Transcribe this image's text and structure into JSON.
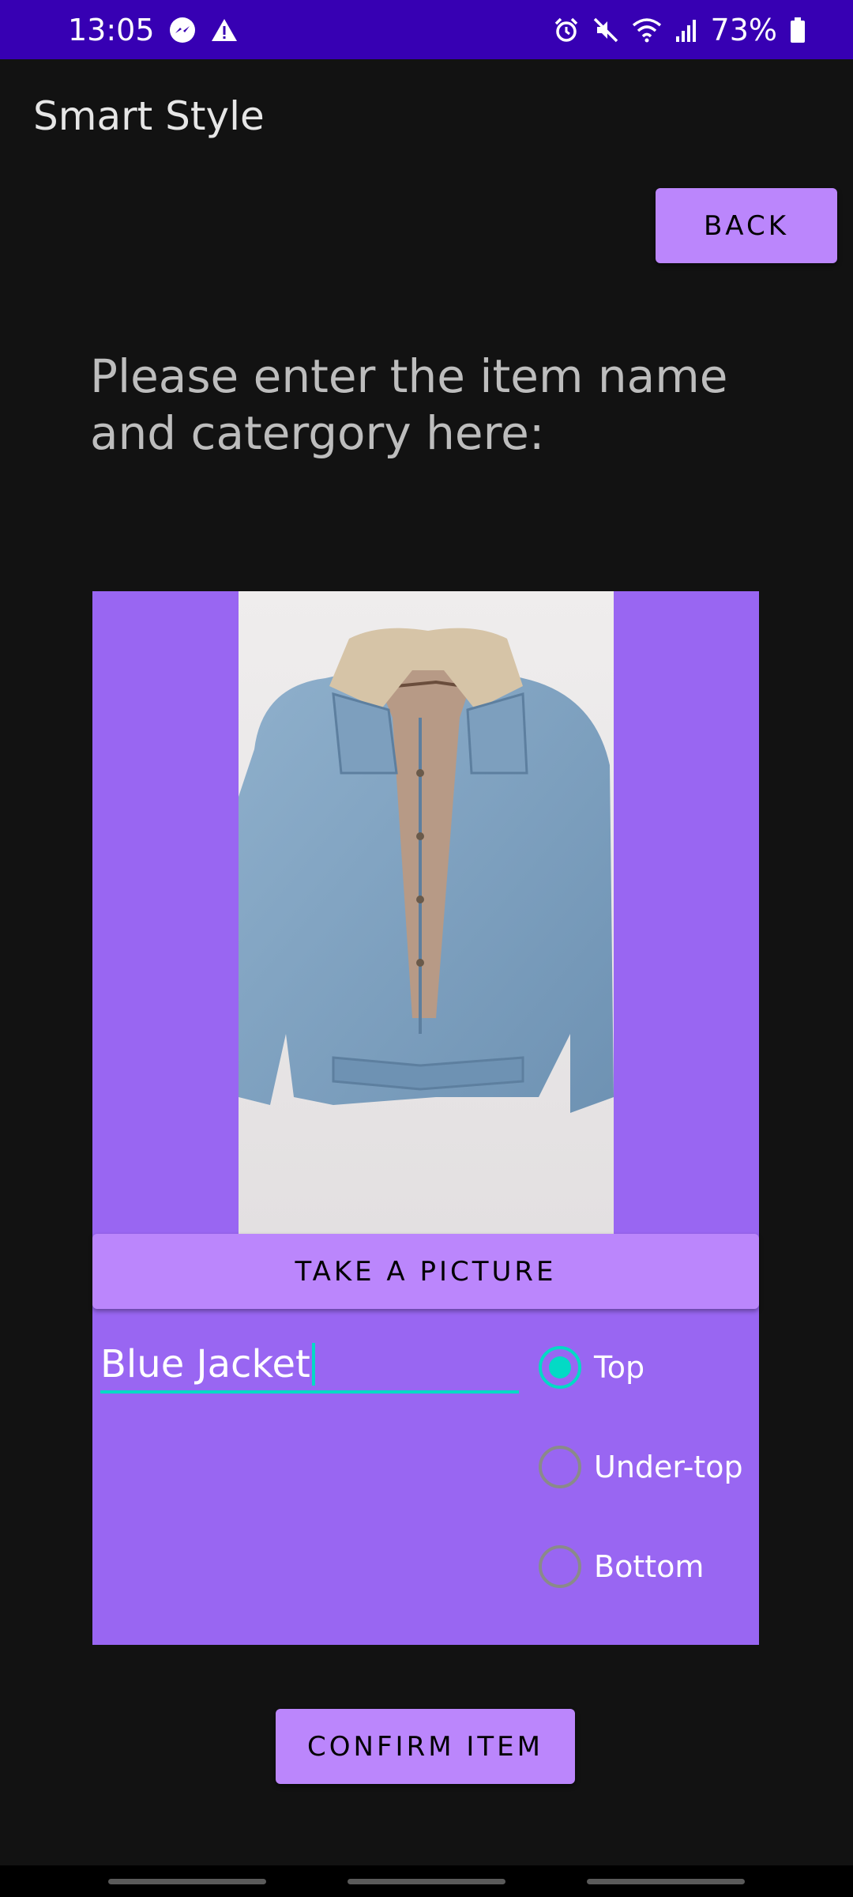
{
  "status_bar": {
    "time": "13:05",
    "battery": "73%",
    "left_icons": [
      "messenger-icon",
      "warning-icon"
    ],
    "right_icons": [
      "alarm-icon",
      "mute-icon",
      "wifi-icon",
      "signal-icon",
      "battery-icon"
    ]
  },
  "app": {
    "title": "Smart Style",
    "back_label": "BACK"
  },
  "form": {
    "instructions": "Please enter the item name and catergory here:",
    "take_picture_label": "TAKE A PICTURE",
    "item_name_value": "Blue Jacket",
    "category_options": [
      {
        "label": "Top",
        "checked": true
      },
      {
        "label": "Under-top",
        "checked": false
      },
      {
        "label": "Bottom",
        "checked": false
      }
    ],
    "confirm_label": "CONFIRM ITEM"
  },
  "colors": {
    "status_bar": "#3700B3",
    "background": "#121212",
    "button": "#BB86FC",
    "panel": "#9966F2",
    "accent": "#03DAC5"
  }
}
